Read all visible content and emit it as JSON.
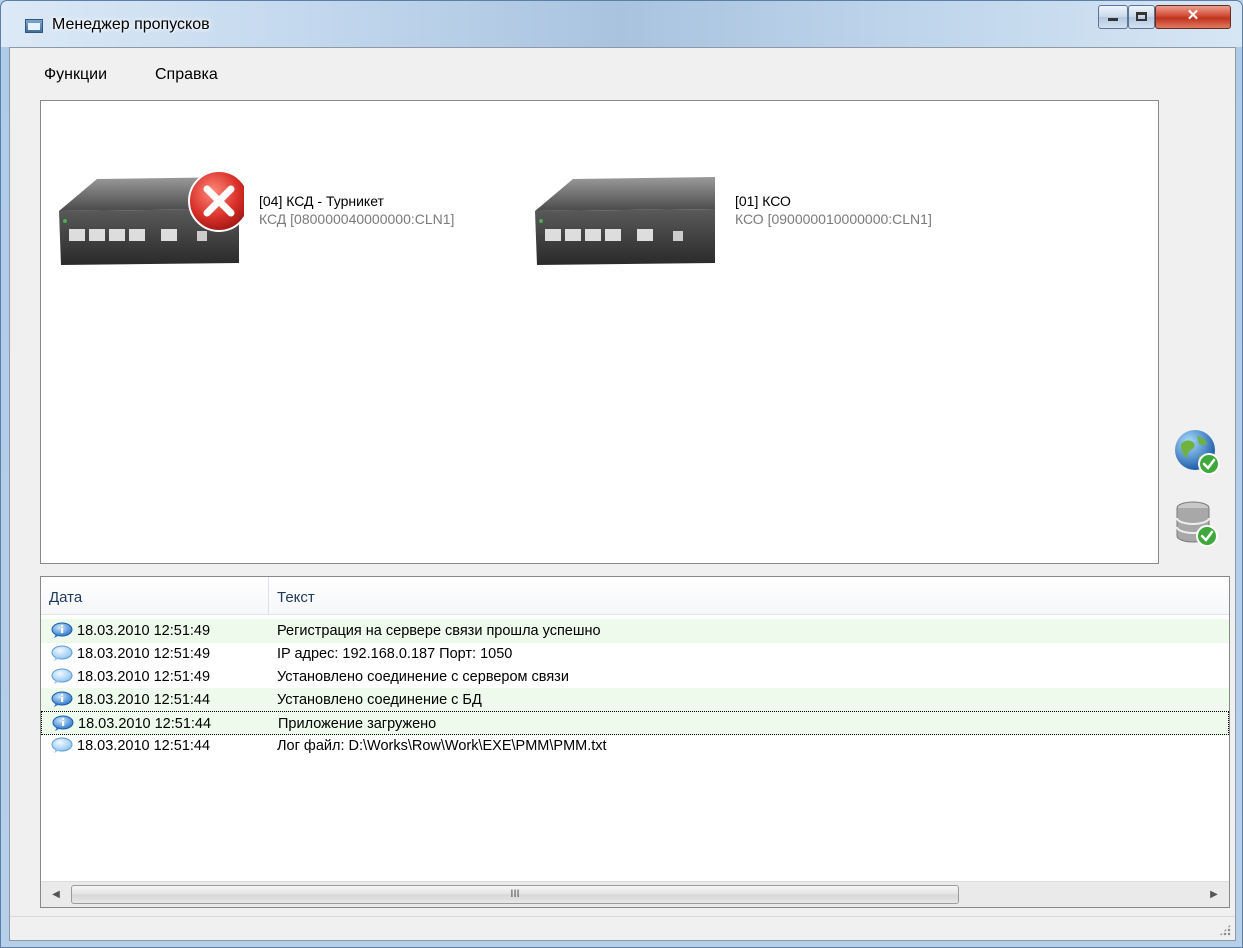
{
  "window": {
    "title": "Менеджер пропусков"
  },
  "menu": {
    "functions": "Функции",
    "help": "Справка"
  },
  "devices": [
    {
      "title": "[04] КСД - Турникет",
      "subtitle": "КСД [080000040000000:CLN1]",
      "status": "error"
    },
    {
      "title": "[01] КСО",
      "subtitle": "КСО [090000010000000:CLN1]",
      "status": "ok"
    }
  ],
  "side_icons": [
    "globe-connected-icon",
    "database-connected-icon"
  ],
  "log": {
    "columns": {
      "date": "Дата",
      "text": "Текст"
    },
    "rows": [
      {
        "icon": "info-bubble-icon",
        "date": "18.03.2010 12:51:49",
        "text": "Регистрация на сервере связи прошла успешно",
        "highlight": true
      },
      {
        "icon": "message-bubble-icon",
        "date": "18.03.2010 12:51:49",
        "text": "IP адрес: 192.168.0.187 Порт: 1050",
        "highlight": false
      },
      {
        "icon": "message-bubble-icon",
        "date": "18.03.2010 12:51:49",
        "text": "Установлено соединение с сервером связи",
        "highlight": false
      },
      {
        "icon": "info-bubble-icon",
        "date": "18.03.2010 12:51:44",
        "text": "Установлено соединение с БД",
        "highlight": true
      },
      {
        "icon": "info-bubble-icon",
        "date": "18.03.2010 12:51:44",
        "text": "Приложение загружено",
        "highlight": true
      },
      {
        "icon": "message-bubble-icon",
        "date": "18.03.2010 12:51:44",
        "text": "Лог файл: D:\\Works\\Row\\Work\\EXE\\PMM\\PMM.txt",
        "highlight": false
      }
    ]
  },
  "scrollbar": {
    "thumb_grip": "III"
  },
  "colors": {
    "highlight_row": "#eefaeb",
    "error_badge": "#d9302a",
    "ok_badge": "#3ea83a"
  }
}
